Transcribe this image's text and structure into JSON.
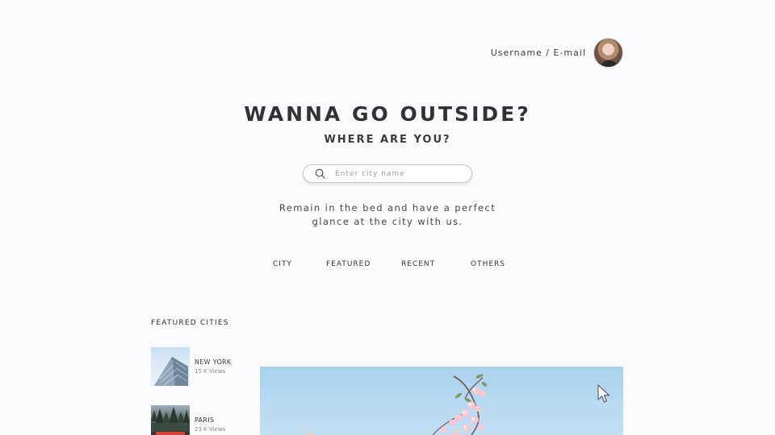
{
  "header": {
    "user_label": "Username / E-mail",
    "avatar_icon": "user-avatar"
  },
  "hero": {
    "title": "WANNA GO OUTSIDE?",
    "subtitle": "WHERE ARE YOU?"
  },
  "search": {
    "placeholder": "Enter city name",
    "value": "",
    "icon": "search-icon"
  },
  "tagline": {
    "line1": "Remain in the bed and have a perfect",
    "line2": "glance at the city with us."
  },
  "tabs": [
    {
      "label": "CITY"
    },
    {
      "label": "FEATURED"
    },
    {
      "label": "RECENT"
    },
    {
      "label": "OTHERS"
    }
  ],
  "featured": {
    "heading": "FEATURED CITIES",
    "cities": [
      {
        "name": "NEW YORK",
        "views": "15 K Views"
      },
      {
        "name": "PARIS",
        "views": "23 K Views"
      }
    ]
  },
  "colors": {
    "background": "#fbfafd",
    "text": "#323236",
    "sky": "#b8daf2",
    "blossom": "#f3c9d2"
  }
}
